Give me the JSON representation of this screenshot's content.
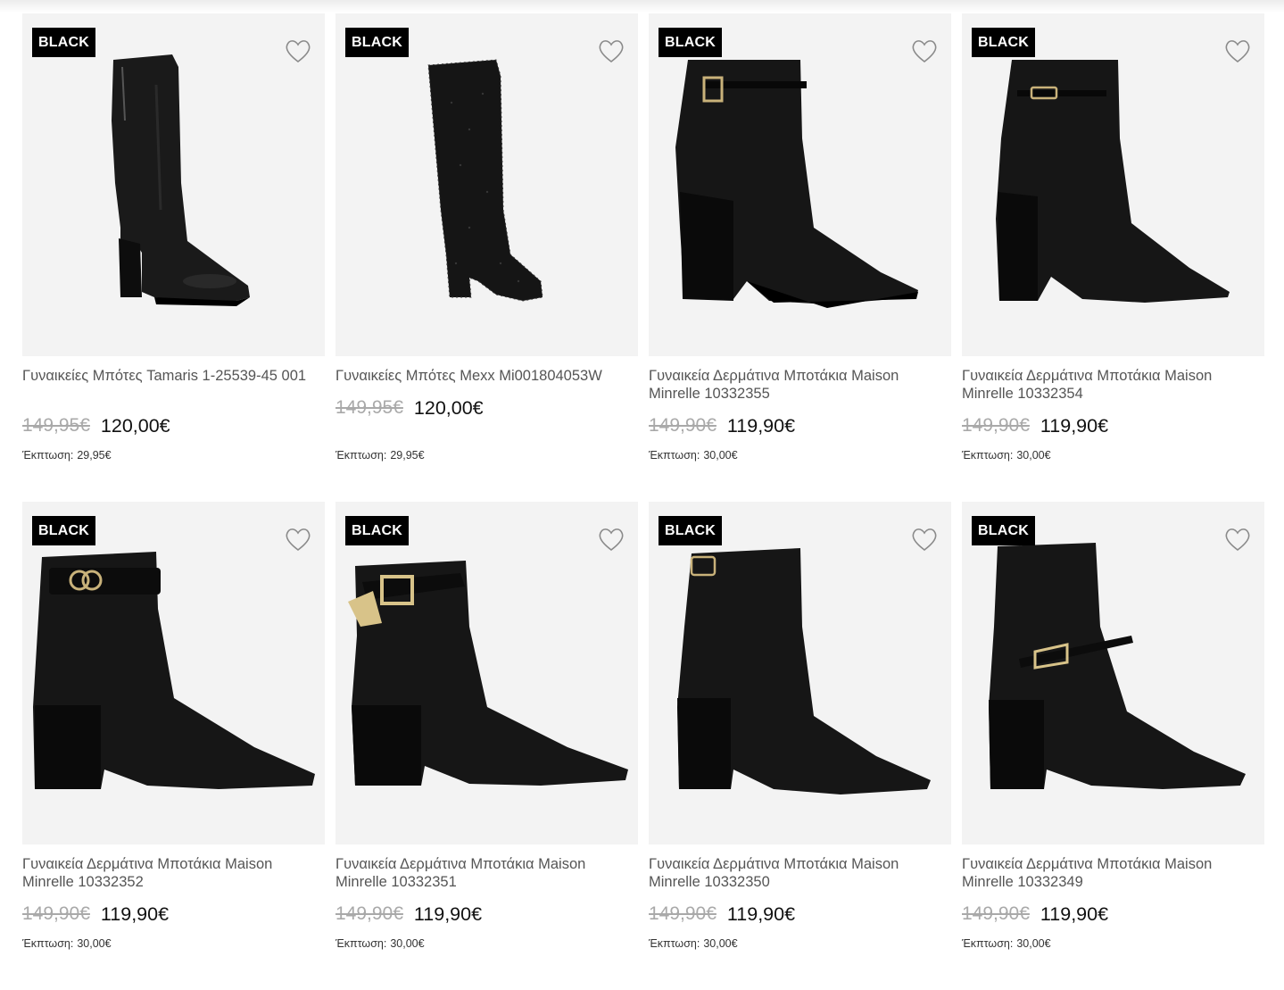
{
  "products": [
    {
      "badge": "BLACK",
      "title": "Γυναικείες Μπότες Tamaris 1-25539-45 001",
      "old_price": "149,95€",
      "new_price": "120,00€",
      "discount_label": "Έκπτωση:",
      "discount_value": "29,95€",
      "image": "tall-boot"
    },
    {
      "badge": "BLACK",
      "title": "Γυναικείες Μπότες Mexx Mi001804053W",
      "old_price": "149,95€",
      "new_price": "120,00€",
      "discount_label": "Έκπτωση:",
      "discount_value": "29,95€",
      "image": "tall-boot-glitter"
    },
    {
      "badge": "BLACK",
      "title": "Γυναικεία Δερμάτινα Μποτάκια Maison Minrelle 10332355",
      "old_price": "149,90€",
      "new_price": "119,90€",
      "discount_label": "Έκπτωση:",
      "discount_value": "30,00€",
      "image": "ankle-boot-buckle"
    },
    {
      "badge": "BLACK",
      "title": "Γυναικεία Δερμάτινα Μποτάκια Maison Minrelle 10332354",
      "old_price": "149,90€",
      "new_price": "119,90€",
      "discount_label": "Έκπτωση:",
      "discount_value": "30,00€",
      "image": "ankle-boot-chain"
    },
    {
      "badge": "BLACK",
      "title": "Γυναικεία Δερμάτινα Μποτάκια Maison Minrelle 10332352",
      "old_price": "149,90€",
      "new_price": "119,90€",
      "discount_label": "Έκπτωση:",
      "discount_value": "30,00€",
      "image": "ankle-boot-strap"
    },
    {
      "badge": "BLACK",
      "title": "Γυναικεία Δερμάτινα Μποτάκια Maison Minrelle 10332351",
      "old_price": "149,90€",
      "new_price": "119,90€",
      "discount_label": "Έκπτωση:",
      "discount_value": "30,00€",
      "image": "ankle-boot-big-buckle"
    },
    {
      "badge": "BLACK",
      "title": "Γυναικεία Δερμάτινα Μποτάκια Maison Minrelle 10332350",
      "old_price": "149,90€",
      "new_price": "119,90€",
      "discount_label": "Έκπτωση:",
      "discount_value": "30,00€",
      "image": "ankle-boot-clasp"
    },
    {
      "badge": "BLACK",
      "title": "Γυναικεία Δερμάτινα Μποτάκια Maison Minrelle 10332349",
      "old_price": "149,90€",
      "new_price": "119,90€",
      "discount_label": "Έκπτωση:",
      "discount_value": "30,00€",
      "image": "ankle-boot-low-strap"
    }
  ],
  "colors": {
    "badge_bg": "#000000",
    "image_bg": "#f3f3f3",
    "old_price": "#a9a9a9",
    "title": "#555555"
  },
  "icons": {
    "wishlist": "heart-outline-icon"
  }
}
